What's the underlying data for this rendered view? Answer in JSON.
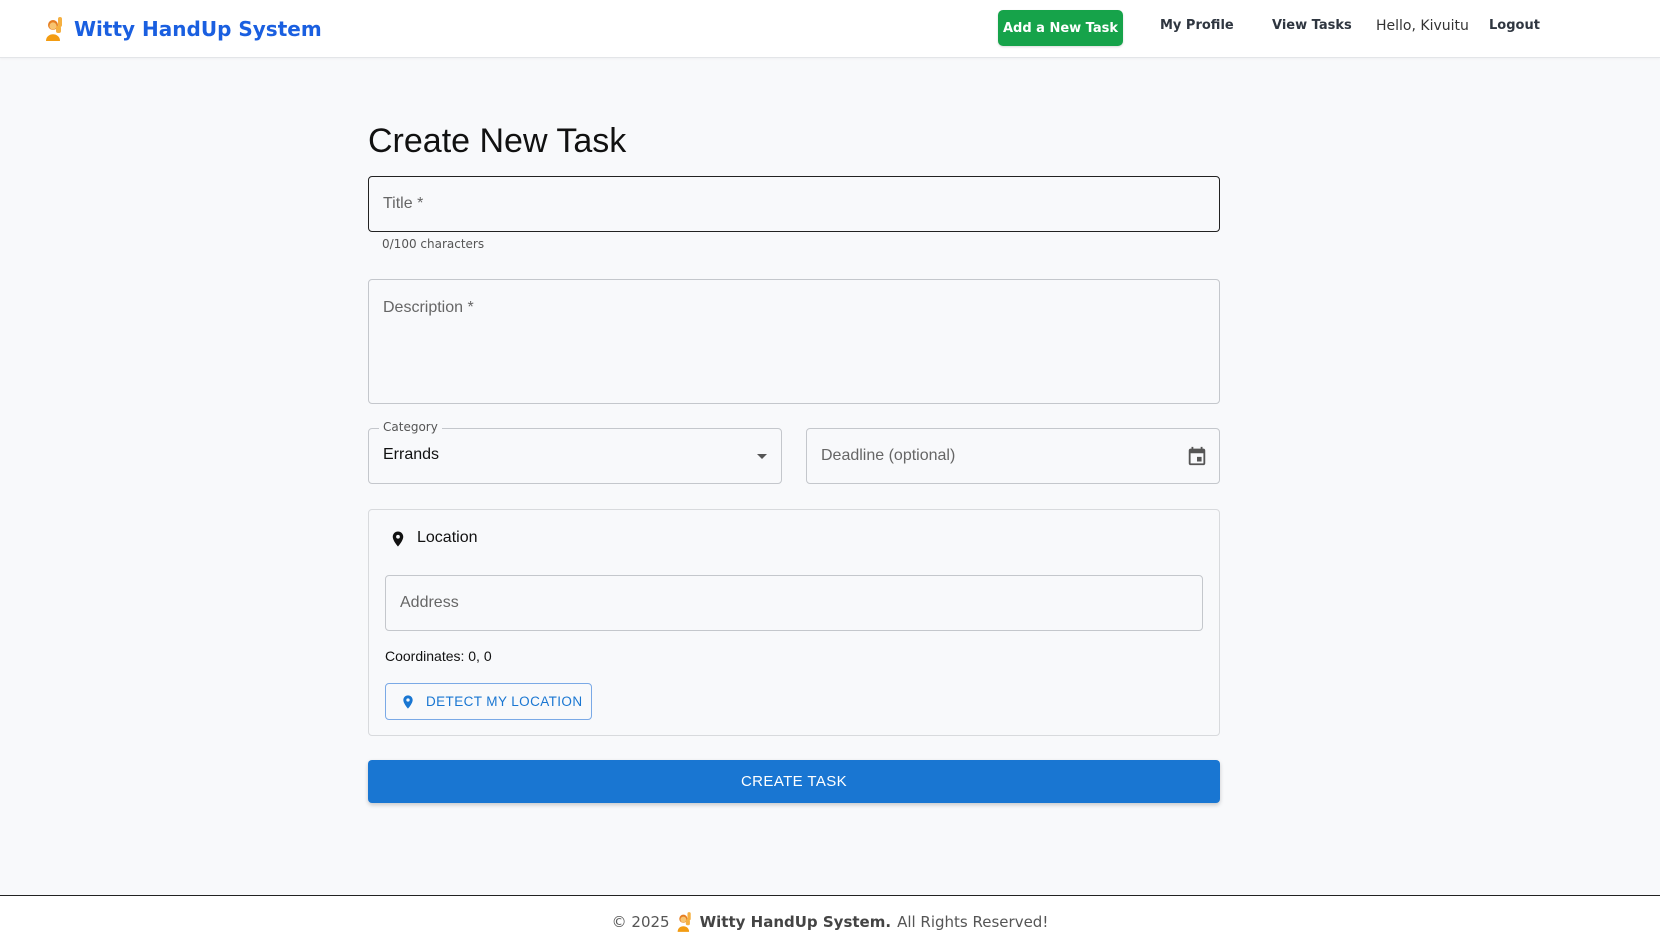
{
  "header": {
    "brand": "Witty HandUp System",
    "add_task": "Add a New Task",
    "my_profile": "My Profile",
    "view_tasks": "View Tasks",
    "greeting": "Hello, Kivuitu",
    "logout": "Logout"
  },
  "form": {
    "title": "Create New Task",
    "title_placeholder": "Title *",
    "title_helper": "0/100 characters",
    "description_placeholder": "Description *",
    "category_label": "Category",
    "category_value": "Errands",
    "deadline_placeholder": "Deadline (optional)",
    "location": {
      "heading": "Location",
      "address_placeholder": "Address",
      "coordinates": "Coordinates: 0, 0",
      "detect_button": "DETECT MY LOCATION"
    },
    "submit": "CREATE TASK"
  },
  "footer": {
    "copyright": "© 2025",
    "brand": "Witty HandUp System.",
    "rights": "All Rights Reserved!"
  },
  "colors": {
    "brand_blue": "#1a5fe0",
    "add_task_green": "#16a34a",
    "primary_button": "#1976d2"
  },
  "icons": [
    "person-raising-hand-icon",
    "calendar-icon",
    "location-pin-icon",
    "dropdown-caret-icon"
  ]
}
